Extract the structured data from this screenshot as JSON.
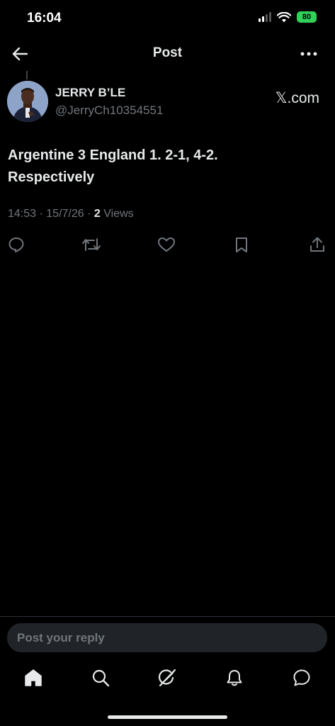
{
  "status_bar": {
    "time": "16:04",
    "battery": "80",
    "icons": [
      "signal-icon",
      "wifi-icon",
      "battery-icon"
    ],
    "battery_color": "#30d158"
  },
  "header": {
    "title": "Post",
    "back_icon": "back-arrow-icon",
    "more_icon": "more-options-icon"
  },
  "post": {
    "author_name": "JERRY B’LE",
    "author_handle": "@JerryCh10354551",
    "source": "𝕏.com",
    "text": "Argentine 3 England 1. 2-1, 4-2.\nRespectively",
    "time": "14:53",
    "date": "15/7/26",
    "views_count": "2",
    "views_label": "Views"
  },
  "actions": [
    "reply-icon",
    "repost-icon",
    "like-icon",
    "bookmark-icon",
    "share-icon"
  ],
  "reply": {
    "placeholder": "Post your reply"
  },
  "tab_bar": [
    "home-icon",
    "search-icon",
    "grok-icon",
    "notifications-icon",
    "messages-icon"
  ],
  "colors": {
    "background": "#000000",
    "text": "#e7e9ea",
    "muted": "#71767b",
    "input_bg": "#202327"
  }
}
